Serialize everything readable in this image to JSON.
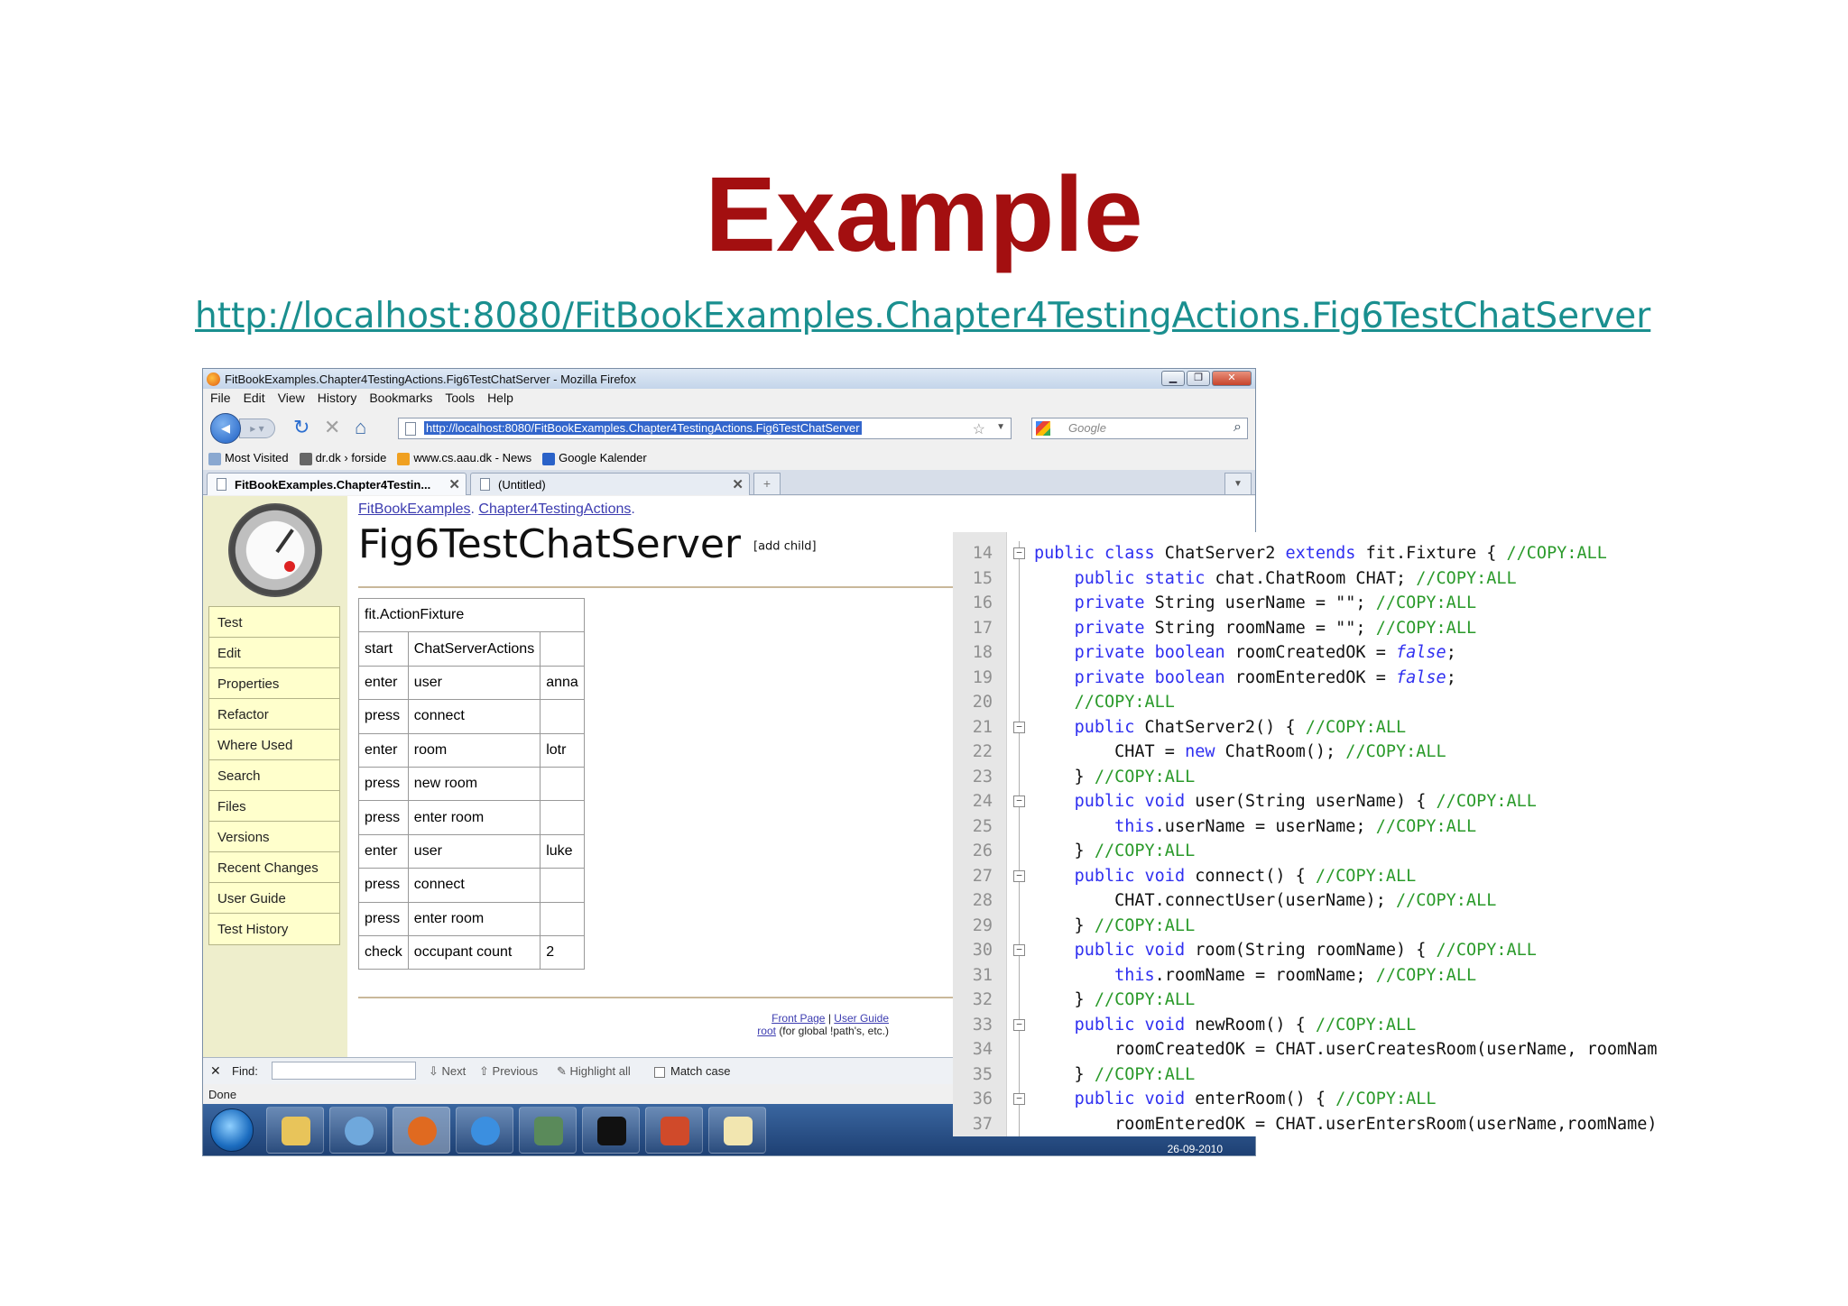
{
  "slide": {
    "title": "Example",
    "link": "http://localhost:8080/FitBookExamples.Chapter4TestingActions.Fig6TestChatServer"
  },
  "browser": {
    "window_title": "FitBookExamples.Chapter4TestingActions.Fig6TestChatServer - Mozilla Firefox",
    "menu": [
      "File",
      "Edit",
      "View",
      "History",
      "Bookmarks",
      "Tools",
      "Help"
    ],
    "url": "http://localhost:8080/FitBookExamples.Chapter4TestingActions.Fig6TestChatServer",
    "search_placeholder": "Google",
    "bookmarks": [
      "Most Visited",
      "dr.dk › forside",
      "www.cs.aau.dk - News",
      "Google Kalender"
    ],
    "tabs": [
      {
        "label": "FitBookExamples.Chapter4Testin..."
      },
      {
        "label": "(Untitled)"
      }
    ],
    "find_label": "Find:",
    "find_next": "Next",
    "find_previous": "Previous",
    "find_highlight": "Highlight all",
    "find_match_case": "Match case",
    "status": "Done",
    "taskbar_date": "26-09-2010"
  },
  "fitnesse": {
    "breadcrumb_1": "FitBookExamples",
    "breadcrumb_2": "Chapter4TestingActions",
    "page_title": "Fig6TestChatServer",
    "add_child": "[add child]",
    "sidebar": [
      "Test",
      "Edit",
      "Properties",
      "Refactor",
      "Where Used",
      "Search",
      "Files",
      "Versions",
      "Recent Changes",
      "User Guide",
      "Test History"
    ],
    "fixture_header": "fit.ActionFixture",
    "rows": [
      [
        "start",
        "ChatServerActions",
        ""
      ],
      [
        "enter",
        "user",
        "anna"
      ],
      [
        "press",
        "connect",
        ""
      ],
      [
        "enter",
        "room",
        "lotr"
      ],
      [
        "press",
        "new room",
        ""
      ],
      [
        "press",
        "enter room",
        ""
      ],
      [
        "enter",
        "user",
        "luke"
      ],
      [
        "press",
        "connect",
        ""
      ],
      [
        "press",
        "enter room",
        ""
      ],
      [
        "check",
        "occupant count",
        "2"
      ]
    ],
    "footer_front_page": "Front Page",
    "footer_sep": "|",
    "footer_user_guide": "User Guide",
    "footer_root": "root",
    "footer_root_note": "(for global !path's, etc.)"
  },
  "code": {
    "lines": [
      {
        "n": "14",
        "t": "public class ChatServer2 extends fit.Fixture { //COPY:ALL"
      },
      {
        "n": "15",
        "t": "    public static chat.ChatRoom CHAT; //COPY:ALL"
      },
      {
        "n": "16",
        "t": "    private String userName = \"\"; //COPY:ALL"
      },
      {
        "n": "17",
        "t": "    private String roomName = \"\"; //COPY:ALL"
      },
      {
        "n": "18",
        "t": "    private boolean roomCreatedOK = false;"
      },
      {
        "n": "19",
        "t": "    private boolean roomEnteredOK = false;"
      },
      {
        "n": "20",
        "t": "    //COPY:ALL"
      },
      {
        "n": "21",
        "t": "    public ChatServer2() { //COPY:ALL"
      },
      {
        "n": "22",
        "t": "        CHAT = new ChatRoom(); //COPY:ALL"
      },
      {
        "n": "23",
        "t": "    } //COPY:ALL"
      },
      {
        "n": "24",
        "t": "    public void user(String userName) { //COPY:ALL"
      },
      {
        "n": "25",
        "t": "        this.userName = userName; //COPY:ALL"
      },
      {
        "n": "26",
        "t": "    } //COPY:ALL"
      },
      {
        "n": "27",
        "t": "    public void connect() { //COPY:ALL"
      },
      {
        "n": "28",
        "t": "        CHAT.connectUser(userName); //COPY:ALL"
      },
      {
        "n": "29",
        "t": "    } //COPY:ALL"
      },
      {
        "n": "30",
        "t": "    public void room(String roomName) { //COPY:ALL"
      },
      {
        "n": "31",
        "t": "        this.roomName = roomName; //COPY:ALL"
      },
      {
        "n": "32",
        "t": "    } //COPY:ALL"
      },
      {
        "n": "33",
        "t": "    public void newRoom() { //COPY:ALL"
      },
      {
        "n": "34",
        "t": "        roomCreatedOK = CHAT.userCreatesRoom(userName, roomNam"
      },
      {
        "n": "35",
        "t": "    } //COPY:ALL"
      },
      {
        "n": "36",
        "t": "    public void enterRoom() { //COPY:ALL"
      },
      {
        "n": "37",
        "t": "        roomEnteredOK = CHAT.userEntersRoom(userName,roomName)"
      }
    ],
    "fold_markers": [
      "14",
      "21",
      "24",
      "27",
      "30",
      "33",
      "36"
    ]
  },
  "colors": {
    "title": "#a30f10",
    "link": "#1a8f8f",
    "keyword": "#2f2ff0",
    "comment": "#2a9a2a",
    "sidebar_bg": "#eeeecc",
    "sidebar_button": "#ffffcc"
  }
}
